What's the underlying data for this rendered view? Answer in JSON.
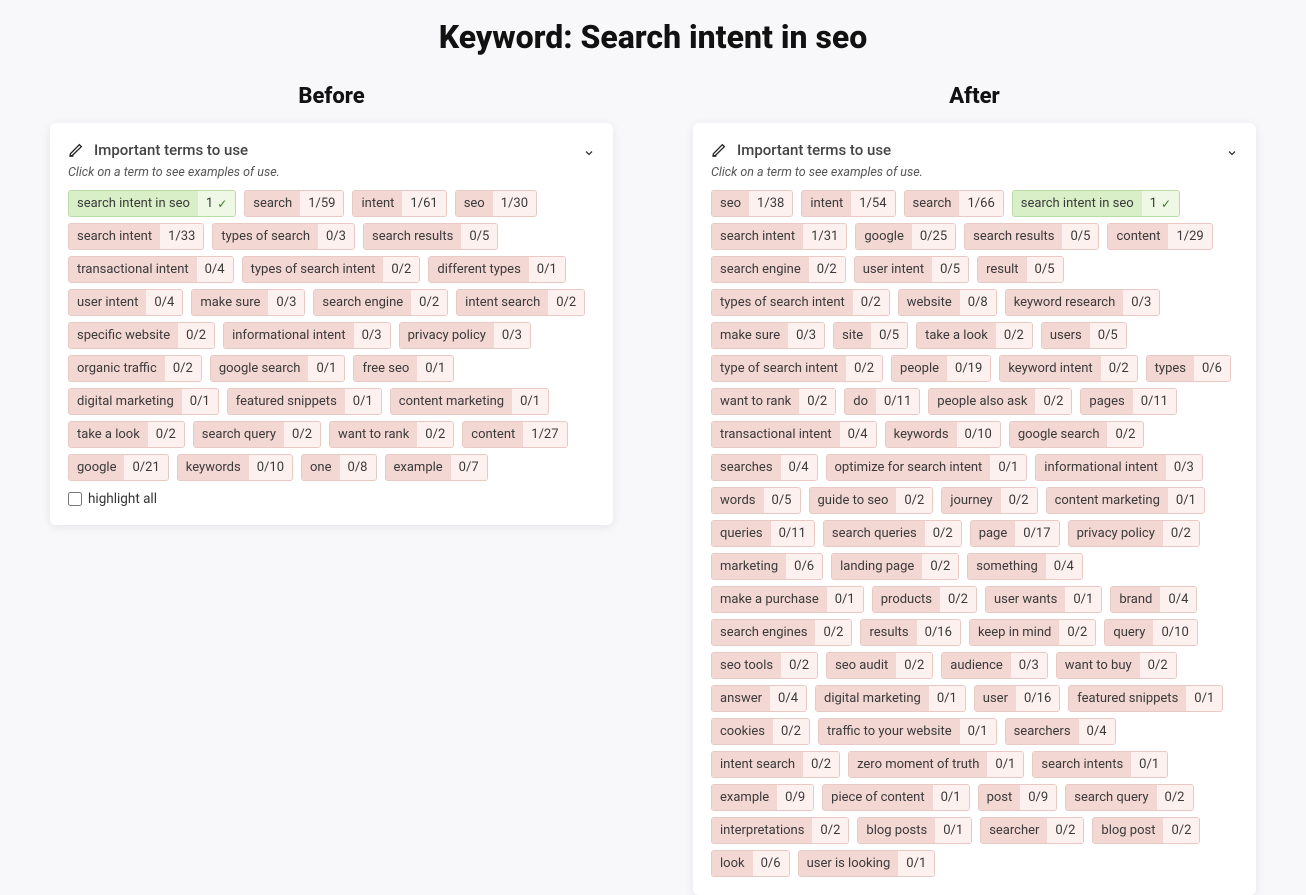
{
  "page_title": "Keyword: Search intent in seo",
  "before_label": "Before",
  "after_label": "After",
  "card_title": "Important terms to use",
  "hint": "Click on a term to see examples of use.",
  "highlight_label": "highlight all",
  "before_terms": [
    {
      "label": "search intent in seo",
      "count": "1",
      "done": true
    },
    {
      "label": "search",
      "count": "1/59"
    },
    {
      "label": "intent",
      "count": "1/61"
    },
    {
      "label": "seo",
      "count": "1/30"
    },
    {
      "label": "search intent",
      "count": "1/33"
    },
    {
      "label": "types of search",
      "count": "0/3"
    },
    {
      "label": "search results",
      "count": "0/5"
    },
    {
      "label": "transactional intent",
      "count": "0/4"
    },
    {
      "label": "types of search intent",
      "count": "0/2"
    },
    {
      "label": "different types",
      "count": "0/1"
    },
    {
      "label": "user intent",
      "count": "0/4"
    },
    {
      "label": "make sure",
      "count": "0/3"
    },
    {
      "label": "search engine",
      "count": "0/2"
    },
    {
      "label": "intent search",
      "count": "0/2"
    },
    {
      "label": "specific website",
      "count": "0/2"
    },
    {
      "label": "informational intent",
      "count": "0/3"
    },
    {
      "label": "privacy policy",
      "count": "0/3"
    },
    {
      "label": "organic traffic",
      "count": "0/2"
    },
    {
      "label": "google search",
      "count": "0/1"
    },
    {
      "label": "free seo",
      "count": "0/1"
    },
    {
      "label": "digital marketing",
      "count": "0/1"
    },
    {
      "label": "featured snippets",
      "count": "0/1"
    },
    {
      "label": "content marketing",
      "count": "0/1"
    },
    {
      "label": "take a look",
      "count": "0/2"
    },
    {
      "label": "search query",
      "count": "0/2"
    },
    {
      "label": "want to rank",
      "count": "0/2"
    },
    {
      "label": "content",
      "count": "1/27"
    },
    {
      "label": "google",
      "count": "0/21"
    },
    {
      "label": "keywords",
      "count": "0/10"
    },
    {
      "label": "one",
      "count": "0/8"
    },
    {
      "label": "example",
      "count": "0/7"
    }
  ],
  "after_terms": [
    {
      "label": "seo",
      "count": "1/38"
    },
    {
      "label": "intent",
      "count": "1/54"
    },
    {
      "label": "search",
      "count": "1/66"
    },
    {
      "label": "search intent in seo",
      "count": "1",
      "done": true
    },
    {
      "label": "search intent",
      "count": "1/31"
    },
    {
      "label": "google",
      "count": "0/25"
    },
    {
      "label": "search results",
      "count": "0/5"
    },
    {
      "label": "content",
      "count": "1/29"
    },
    {
      "label": "search engine",
      "count": "0/2"
    },
    {
      "label": "user intent",
      "count": "0/5"
    },
    {
      "label": "result",
      "count": "0/5"
    },
    {
      "label": "types of search intent",
      "count": "0/2"
    },
    {
      "label": "website",
      "count": "0/8"
    },
    {
      "label": "keyword research",
      "count": "0/3"
    },
    {
      "label": "make sure",
      "count": "0/3"
    },
    {
      "label": "site",
      "count": "0/5"
    },
    {
      "label": "take a look",
      "count": "0/2"
    },
    {
      "label": "users",
      "count": "0/5"
    },
    {
      "label": "type of search intent",
      "count": "0/2"
    },
    {
      "label": "people",
      "count": "0/19"
    },
    {
      "label": "keyword intent",
      "count": "0/2"
    },
    {
      "label": "types",
      "count": "0/6"
    },
    {
      "label": "want to rank",
      "count": "0/2"
    },
    {
      "label": "do",
      "count": "0/11"
    },
    {
      "label": "people also ask",
      "count": "0/2"
    },
    {
      "label": "pages",
      "count": "0/11"
    },
    {
      "label": "transactional intent",
      "count": "0/4"
    },
    {
      "label": "keywords",
      "count": "0/10"
    },
    {
      "label": "google search",
      "count": "0/2"
    },
    {
      "label": "searches",
      "count": "0/4"
    },
    {
      "label": "optimize for search intent",
      "count": "0/1"
    },
    {
      "label": "informational intent",
      "count": "0/3"
    },
    {
      "label": "words",
      "count": "0/5"
    },
    {
      "label": "guide to seo",
      "count": "0/2"
    },
    {
      "label": "journey",
      "count": "0/2"
    },
    {
      "label": "content marketing",
      "count": "0/1"
    },
    {
      "label": "queries",
      "count": "0/11"
    },
    {
      "label": "search queries",
      "count": "0/2"
    },
    {
      "label": "page",
      "count": "0/17"
    },
    {
      "label": "privacy policy",
      "count": "0/2"
    },
    {
      "label": "marketing",
      "count": "0/6"
    },
    {
      "label": "landing page",
      "count": "0/2"
    },
    {
      "label": "something",
      "count": "0/4"
    },
    {
      "label": "make a purchase",
      "count": "0/1"
    },
    {
      "label": "products",
      "count": "0/2"
    },
    {
      "label": "user wants",
      "count": "0/1"
    },
    {
      "label": "brand",
      "count": "0/4"
    },
    {
      "label": "search engines",
      "count": "0/2"
    },
    {
      "label": "results",
      "count": "0/16"
    },
    {
      "label": "keep in mind",
      "count": "0/2"
    },
    {
      "label": "query",
      "count": "0/10"
    },
    {
      "label": "seo tools",
      "count": "0/2"
    },
    {
      "label": "seo audit",
      "count": "0/2"
    },
    {
      "label": "audience",
      "count": "0/3"
    },
    {
      "label": "want to buy",
      "count": "0/2"
    },
    {
      "label": "answer",
      "count": "0/4"
    },
    {
      "label": "digital marketing",
      "count": "0/1"
    },
    {
      "label": "user",
      "count": "0/16"
    },
    {
      "label": "featured snippets",
      "count": "0/1"
    },
    {
      "label": "cookies",
      "count": "0/2"
    },
    {
      "label": "traffic to your website",
      "count": "0/1"
    },
    {
      "label": "searchers",
      "count": "0/4"
    },
    {
      "label": "intent search",
      "count": "0/2"
    },
    {
      "label": "zero moment of truth",
      "count": "0/1"
    },
    {
      "label": "search intents",
      "count": "0/1"
    },
    {
      "label": "example",
      "count": "0/9"
    },
    {
      "label": "piece of content",
      "count": "0/1"
    },
    {
      "label": "post",
      "count": "0/9"
    },
    {
      "label": "search query",
      "count": "0/2"
    },
    {
      "label": "interpretations",
      "count": "0/2"
    },
    {
      "label": "blog posts",
      "count": "0/1"
    },
    {
      "label": "searcher",
      "count": "0/2"
    },
    {
      "label": "blog post",
      "count": "0/2"
    },
    {
      "label": "look",
      "count": "0/6"
    },
    {
      "label": "user is looking",
      "count": "0/1"
    }
  ]
}
